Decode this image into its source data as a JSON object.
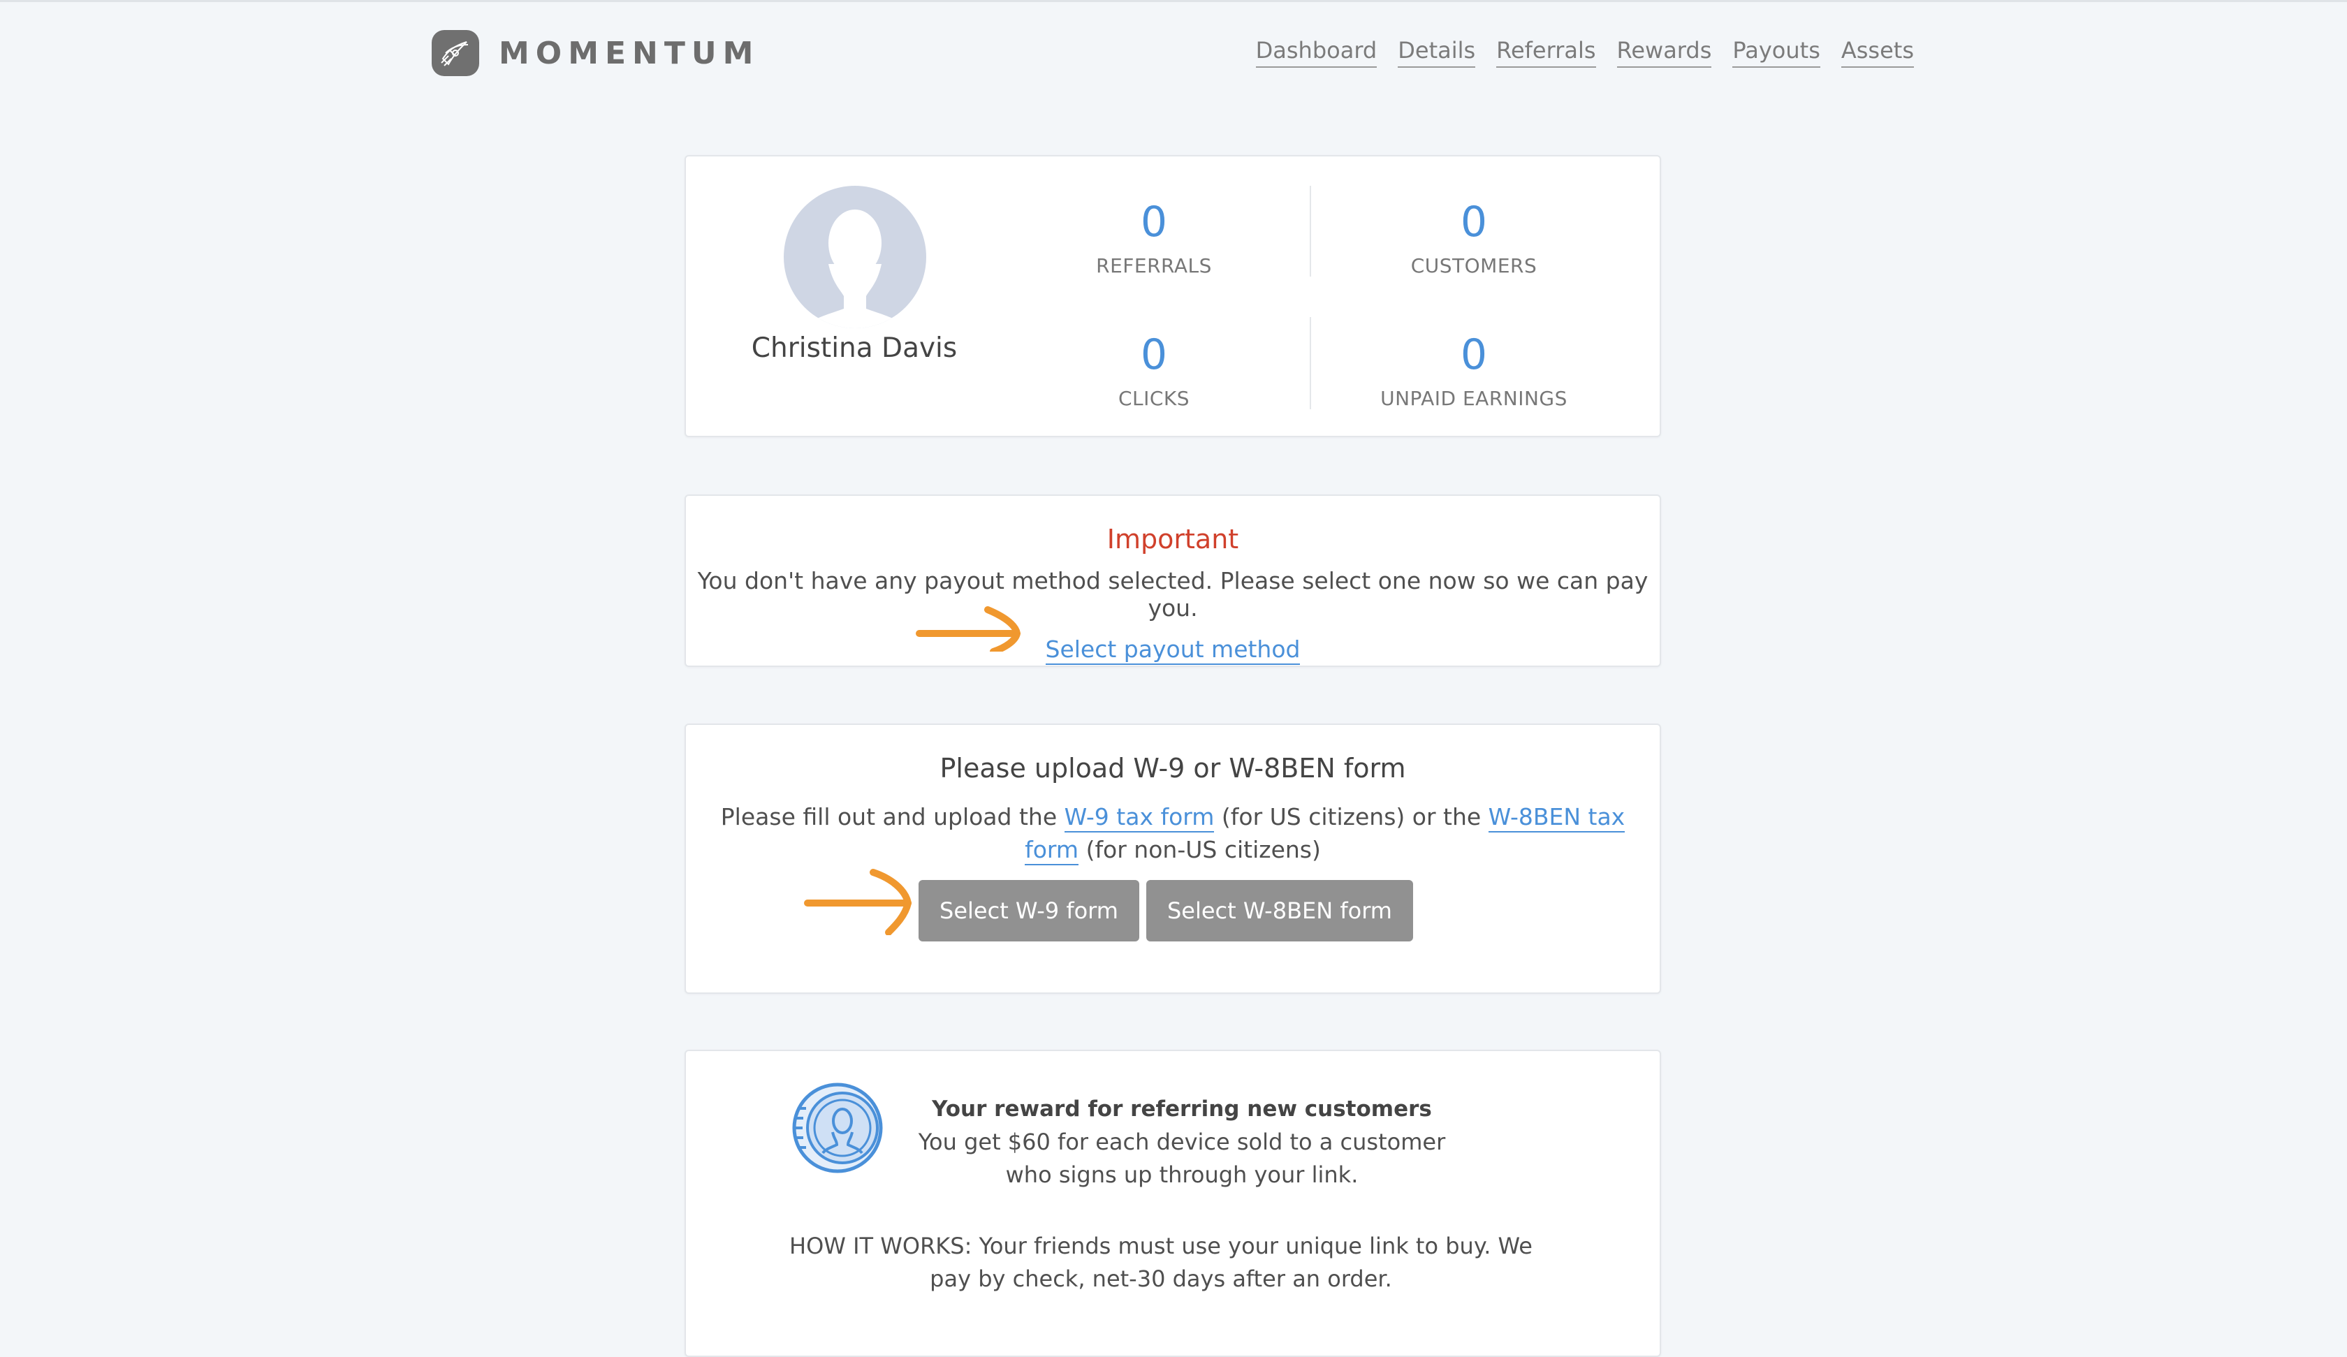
{
  "brand": {
    "name": "MOMENTUM"
  },
  "nav": [
    {
      "label": "Dashboard"
    },
    {
      "label": "Details"
    },
    {
      "label": "Referrals"
    },
    {
      "label": "Rewards"
    },
    {
      "label": "Payouts"
    },
    {
      "label": "Assets"
    }
  ],
  "profile": {
    "name": "Christina Davis",
    "stats": {
      "referrals": {
        "value": "0",
        "label": "REFERRALS"
      },
      "customers": {
        "value": "0",
        "label": "CUSTOMERS"
      },
      "clicks": {
        "value": "0",
        "label": "CLICKS"
      },
      "unpaid": {
        "value": "0",
        "label": "UNPAID EARNINGS"
      }
    }
  },
  "important": {
    "title": "Important",
    "message": "You don't have any payout method selected. Please select one now so we can pay you.",
    "link": "Select payout method"
  },
  "upload": {
    "title": "Please upload W-9 or W-8BEN form",
    "msg_prefix": "Please fill out and upload the ",
    "w9_link": "W-9 tax form",
    "msg_middle": " (for US citizens) or the ",
    "w8_link": "W-8BEN tax form",
    "msg_suffix": " (for non-US citizens)",
    "w9_button": "Select W-9 form",
    "w8_button": "Select W-8BEN form"
  },
  "reward": {
    "title": "Your reward for referring new customers",
    "text": "You get $60 for each device sold to a customer who signs up through your link.",
    "how": "HOW IT WORKS: Your friends must use your unique link to buy. We pay by check, net-30 days after an order."
  },
  "colors": {
    "accent": "#4a90d9",
    "alert": "#d0402b",
    "arrow": "#f0982f",
    "button": "#919191"
  }
}
